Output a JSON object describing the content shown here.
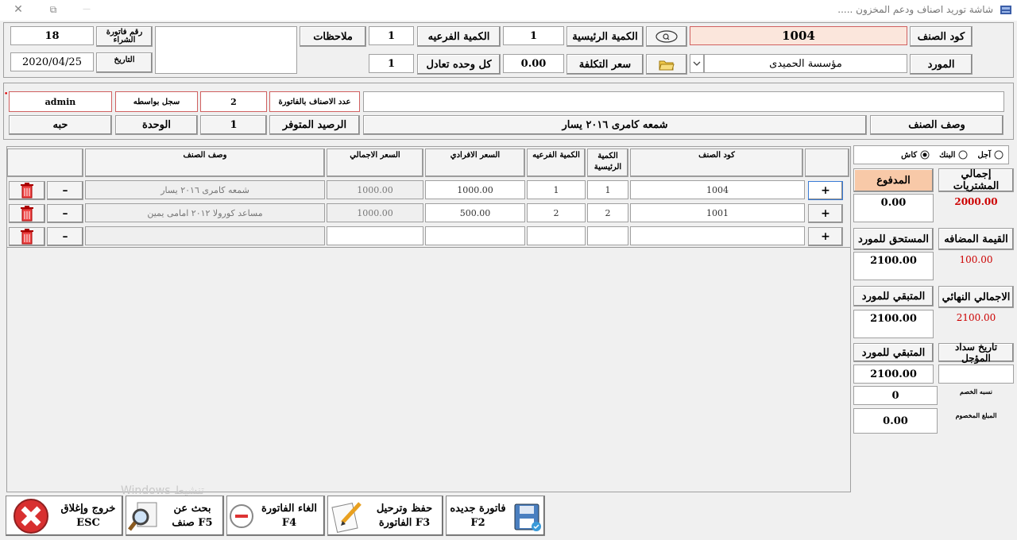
{
  "window": {
    "title": "..... شاشة توريد اصناف ودعم المخزون",
    "close": "✕",
    "restore": "⧉",
    "minimize": "—"
  },
  "header": {
    "item_code_label": "كود الصنف",
    "item_code_value": "1004",
    "main_qty_label": "الكمية الرئيسية",
    "main_qty_value": "1",
    "sub_qty_label": "الكمية الفرعيه",
    "sub_qty_value": "1",
    "notes_label": "ملاحظات",
    "purchase_invoice_no_label": "رقم فاتورة الشراء",
    "purchase_invoice_no_value": "18",
    "supplier_label": "المورد",
    "supplier_value": "مؤسسة الحميدى",
    "cost_price_label": "سعر التكلفة",
    "cost_price_value": "0.00",
    "unit_equiv_label": "كل وحده تعادل",
    "unit_equiv_value": "1",
    "date_label": "التاريخ",
    "date_value": "2020/04/25"
  },
  "info": {
    "items_count_label": "عدد الاصناف بالفاتورة",
    "items_count_value": "2",
    "registered_by_label": "سجل بواسطه",
    "registered_by_value": "admin",
    "item_desc_label": "وصف الصنف",
    "item_desc_value": "شمعه كامرى ٢٠١٦ يسار",
    "available_balance_label": "الرصيد المتوفر",
    "available_balance_value": "1",
    "unit_label": "الوحدة",
    "unit_value": "حبه"
  },
  "table": {
    "headers": {
      "item_code": "كود الصنف",
      "main_qty": "الكمية الرئيسية",
      "sub_qty": "الكمية الفرعيه",
      "unit_price": "السعر الافرادي",
      "total_price": "السعر الاجمالي",
      "item_desc": "وصف الصنف"
    },
    "rows": [
      {
        "code": "1004",
        "main_qty": "1",
        "sub_qty": "1",
        "unit_price": "1000.00",
        "total": "1000.00",
        "desc": "شمعه كامرى ٢٠١٦ يسار"
      },
      {
        "code": "1001",
        "main_qty": "2",
        "sub_qty": "2",
        "unit_price": "500.00",
        "total": "1000.00",
        "desc": "مساعد كورولا ٢٠١٢ امامى يمين"
      },
      {
        "code": "",
        "main_qty": "",
        "sub_qty": "",
        "unit_price": "",
        "total": "",
        "desc": ""
      }
    ],
    "add_symbol": "+",
    "minus_symbol": "–"
  },
  "payment": {
    "cash_label": "كاش",
    "bank_label": "البنك",
    "credit_label": "آجل",
    "selected": "cash"
  },
  "totals": {
    "purchases_total_label": "إجمالي المشتريات",
    "purchases_total_value": "2000.00",
    "paid_label": "المدفوع",
    "paid_value": "0.00",
    "vat_label": "القيمة المضافه",
    "vat_value": "100.00",
    "due_supplier_label": "المستحق للمورد",
    "due_supplier_value": "2100.00",
    "final_total_label": "الاجمالي النهائي",
    "final_total_value": "2100.00",
    "remaining_label": "المتبقي للمورد",
    "remaining_value": "2100.00",
    "deferred_date_label": "تاريخ سداد المؤجل",
    "remaining2_label": "المتبقي للمورد",
    "remaining2_value": "2100.00",
    "discount_pct_label": "نسبه الخصم",
    "discount_pct_value": "0",
    "discount_amount_label": "المبلغ المخصوم",
    "discount_amount_value": "0.00"
  },
  "actions": {
    "new_invoice": {
      "line1": "فاتورة جديده",
      "line2": "F2"
    },
    "save_post": {
      "line1": "حفظ وترحيل",
      "line2": "الفاتورة F3"
    },
    "cancel_invoice": {
      "line1": "الغاء الفاتورة",
      "line2": "F4"
    },
    "search_item": {
      "line1": "بحث عن",
      "line2": "صنف F5"
    },
    "exit": {
      "line1": "خروج وإغلاق",
      "line2": "ESC"
    }
  },
  "watermark": "Windows تنشيط"
}
